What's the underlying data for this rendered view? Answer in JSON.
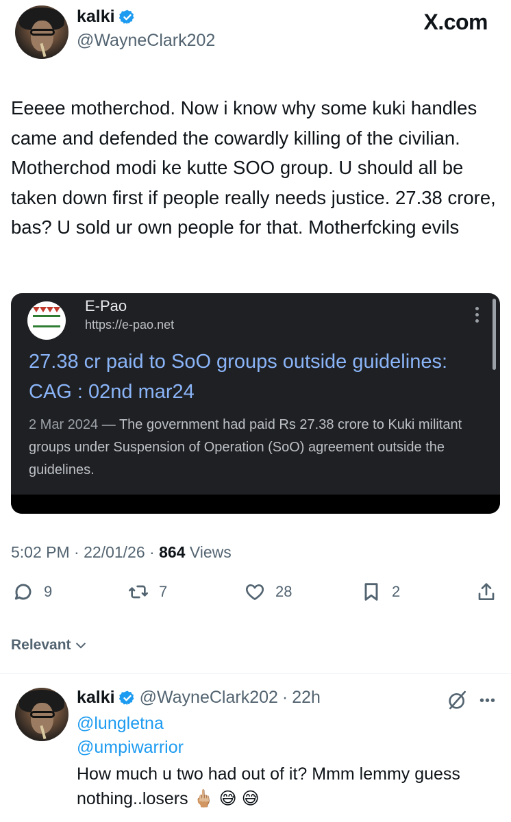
{
  "header": {
    "display_name": "kalki",
    "handle": "@WayneClark202",
    "site_logo": "X.com"
  },
  "tweet": {
    "text": "Eeeee motherchod. Now i know why some kuki handles came and defended the cowardly killing of the civilian. Motherchod modi ke kutte SOO group. U should all be taken down first if people really needs justice. 27.38 crore, bas? U sold ur own people for that. Motherfcking evils",
    "time": "5:02 PM",
    "date": "22/01/26",
    "views_count": "864",
    "views_label": "Views",
    "sep": "·"
  },
  "card": {
    "site_name": "E-Pao",
    "url": "https://e-pao.net",
    "title": "27.38 cr paid to SoO groups outside guidelines: CAG : 02nd mar24",
    "date": "2 Mar 2024",
    "dash": "—",
    "description": "The government had paid Rs 27.38 crore to Kuki militant groups under Suspension of Operation (SoO) agreement outside the guidelines."
  },
  "actions": {
    "replies": "9",
    "reposts": "7",
    "likes": "28",
    "bookmarks": "2"
  },
  "sort": {
    "label": "Relevant"
  },
  "reply": {
    "display_name": "kalki",
    "handle": "@WayneClark202",
    "sep": "·",
    "age": "22h",
    "mention1": "@lungletna",
    "mention2": "@umpiwarrior",
    "text": "How much u two had out of it? Mmm lemmy guess nothing..losers 🖕🏼 😅 😅"
  },
  "colors": {
    "accent_blue": "#1d9bf0",
    "card_bg": "#1f2023",
    "card_title": "#8ab4f8",
    "muted": "#536471"
  }
}
